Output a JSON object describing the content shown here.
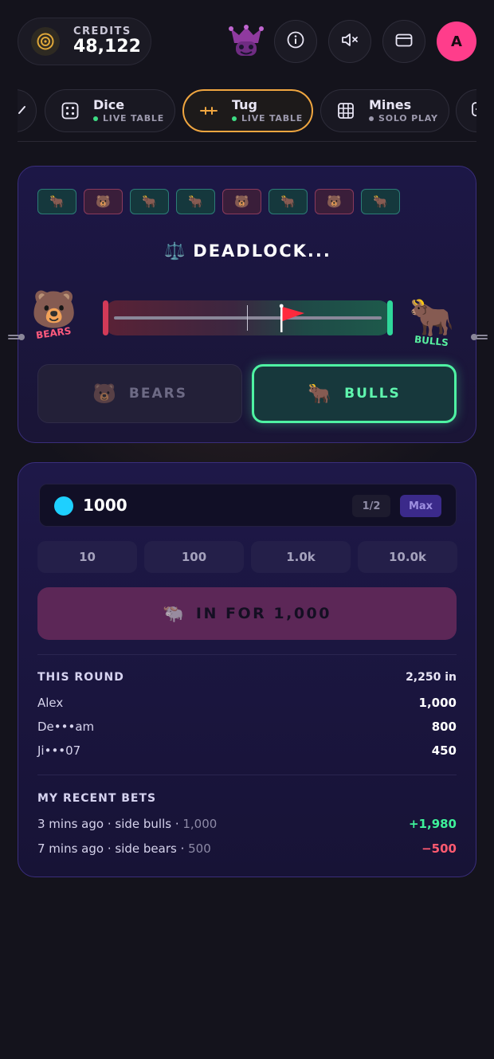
{
  "header": {
    "credits_label": "CREDITS",
    "credits_value": "48,122",
    "avatar_initial": "A"
  },
  "tabs": [
    {
      "name": "Dice",
      "status": "LIVE TABLE",
      "status_color": "#3ddc84",
      "active": false
    },
    {
      "name": "Tug",
      "status": "LIVE TABLE",
      "status_color": "#3ddc84",
      "active": true
    },
    {
      "name": "Mines",
      "status": "SOLO PLAY",
      "status_color": "#9c99ad",
      "active": false
    }
  ],
  "game": {
    "history": [
      "bull",
      "bear",
      "bull",
      "bull",
      "bear",
      "bull",
      "bear",
      "bull"
    ],
    "status": "DEADLOCK...",
    "bears_label": "BEARS",
    "bulls_label": "BULLS",
    "flag_position": 0.62,
    "bears_button": "BEARS",
    "bulls_button": "BULLS",
    "selected_side": "bulls"
  },
  "bet": {
    "amount": "1000",
    "half_label": "1/2",
    "max_label": "Max",
    "quick_amounts": [
      "10",
      "100",
      "1.0k",
      "10.0k"
    ],
    "place_label": "IN FOR 1,000"
  },
  "round": {
    "title": "THIS ROUND",
    "total": "2,250 in",
    "players": [
      {
        "name": "Alex",
        "amount": "1,000"
      },
      {
        "name": "De•••am",
        "amount": "800"
      },
      {
        "name": "Ji•••07",
        "amount": "450"
      }
    ]
  },
  "recent": {
    "title": "MY RECENT BETS",
    "bets": [
      {
        "desc": "3 mins ago · side bulls ·",
        "stake": "1,000",
        "result": "+1,980",
        "outcome": "win"
      },
      {
        "desc": "7 mins ago · side bears ·",
        "stake": "500",
        "result": "−500",
        "outcome": "loss"
      }
    ]
  },
  "colors": {
    "accent_orange": "#f0a640",
    "bulls_green": "#4ef2a3",
    "bears_pink": "#ff5a7d",
    "avatar_pink": "#ff3d8b",
    "chip_cyan": "#1ed0ff"
  },
  "icons": {
    "credits": "target-coin-icon",
    "brand": "jester-mascot-icon",
    "info": "info-icon",
    "sound": "mute-icon",
    "wallet": "wallet-icon",
    "dice": "dice-icon",
    "tug": "rope-icon",
    "mines": "grid-icon"
  }
}
